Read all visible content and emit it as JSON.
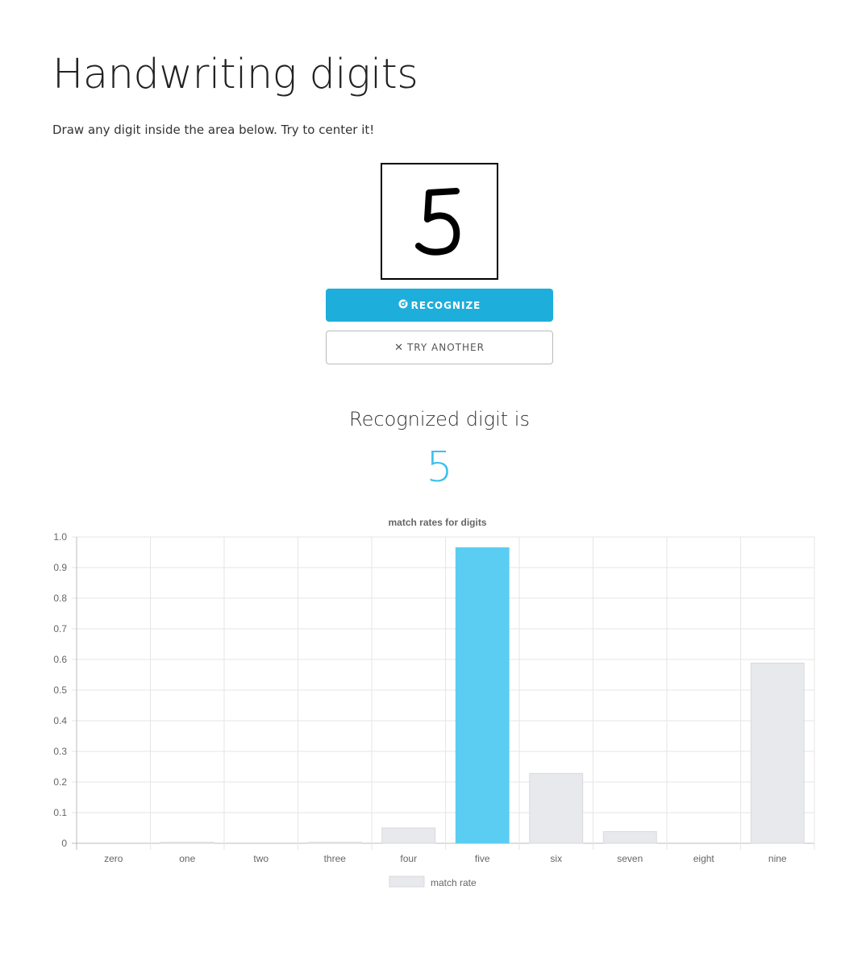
{
  "page": {
    "title": "Handwriting digits",
    "instructions": "Draw any digit inside the area below. Try to center it!"
  },
  "drawing_canvas": {
    "drawn_digit": "5"
  },
  "buttons": {
    "recognize_icon": "recognize-icon",
    "recognize_label": "RECOGNIZE",
    "try_another_icon": "close-icon",
    "try_another_symbol": "✕",
    "try_another_label": "TRY ANOTHER"
  },
  "result": {
    "heading": "Recognized digit is",
    "digit": "5",
    "accent_color": "#3ac0ec"
  },
  "chart_data": {
    "type": "bar",
    "title": "match rates for digits",
    "categories": [
      "zero",
      "one",
      "two",
      "three",
      "four",
      "five",
      "six",
      "seven",
      "eight",
      "nine"
    ],
    "series": [
      {
        "name": "match rate",
        "values": [
          0.0,
          0.003,
          0.0,
          0.003,
          0.05,
          0.965,
          0.228,
          0.038,
          0.0,
          0.588
        ]
      }
    ],
    "highlight_index": 5,
    "highlight_color": "#5bcdf2",
    "bar_color": "#e8e9ec",
    "yticks": [
      "0",
      "0.1",
      "0.2",
      "0.3",
      "0.4",
      "0.5",
      "0.6",
      "0.7",
      "0.8",
      "0.9",
      "1.0"
    ],
    "ylim": [
      0,
      1
    ],
    "grid": true,
    "legend_position": "bottom"
  }
}
